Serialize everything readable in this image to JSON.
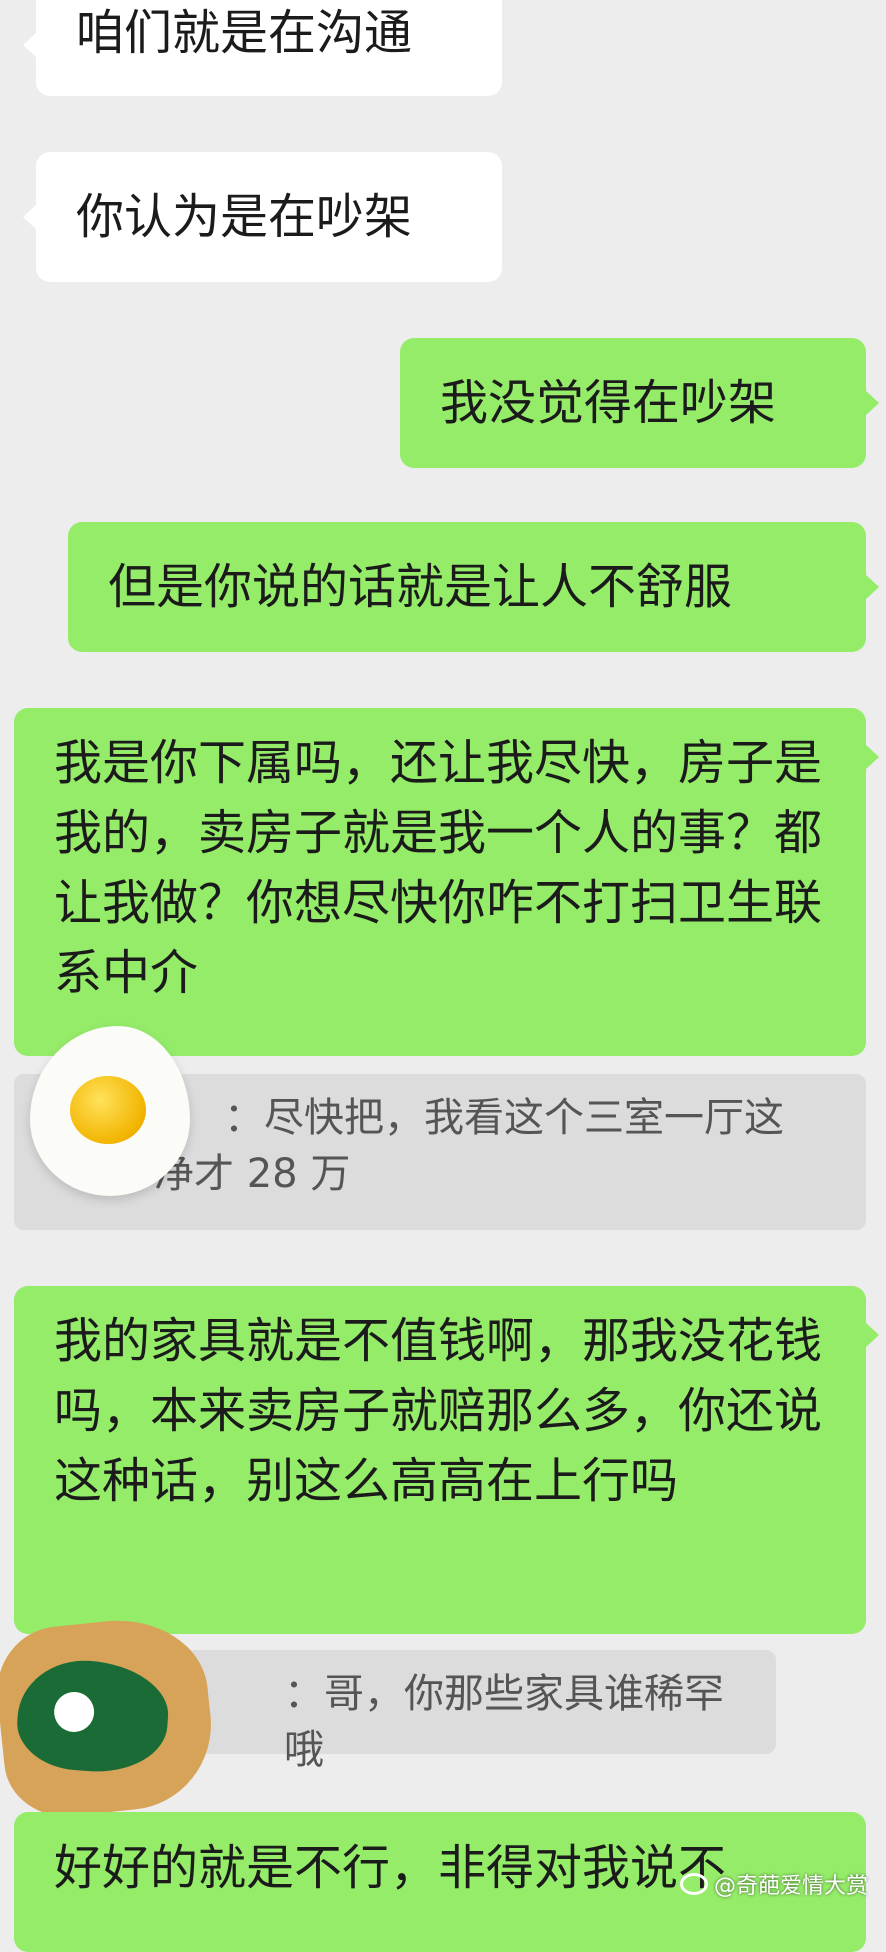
{
  "messages": [
    {
      "text": "咱们就是在沟通"
    },
    {
      "text": "你认为是在吵架"
    },
    {
      "text": "我没觉得在吵架"
    },
    {
      "text": "但是你说的话就是让人不舒服"
    },
    {
      "text": "我是你下属吗，还让我尽快，房子是我的，卖房子就是我一个人的事？都让我做？你想尽快你咋不打扫卫生联系中介"
    },
    {
      "text": "我的家具就是不值钱啊，那我没花钱吗，本来卖房子就赔那么多，你还说这种话，别这么高高在上行吗"
    },
    {
      "text": "好好的就是不行，非得对我说不"
    }
  ],
  "quotes": [
    {
      "text": "：尽快把，我看这个三室一厅这"
    },
    {
      "text": "净才 28 万"
    },
    {
      "text": "：哥，你那些家具谁稀罕哦"
    }
  ],
  "watermark": {
    "text": "@奇葩爱情大赏"
  },
  "colors": {
    "sent_bubble": "#95ec69",
    "received_bubble": "#ffffff",
    "background": "#ededed"
  }
}
